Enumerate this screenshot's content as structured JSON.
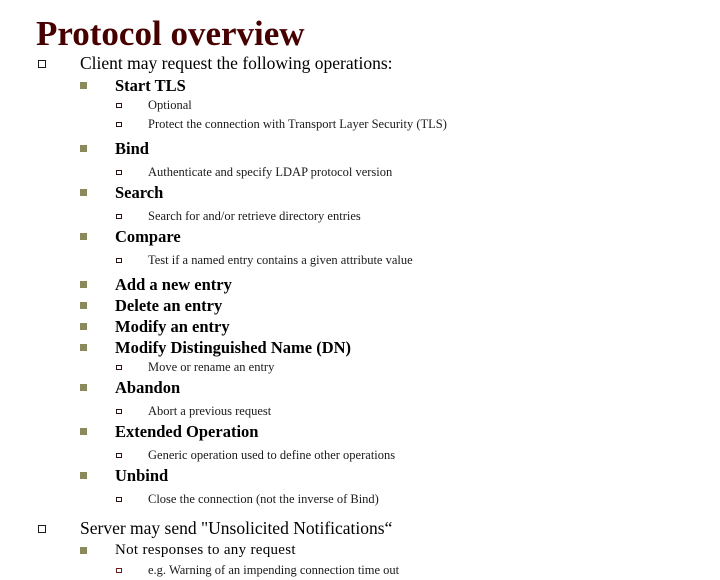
{
  "slide": {
    "title": "Protocol overview",
    "title_color": "#470000",
    "background_color": "#ffffff",
    "bullet_colors": {
      "level1": "#1a1a1a",
      "level2": "#8a8a5c",
      "level3": "#2b1414",
      "level3_accent": "#6b2020"
    },
    "outline": {
      "client_section": {
        "heading": "Client may request the following operations:",
        "operations": [
          {
            "name": "Start TLS",
            "details": [
              "Optional",
              "Protect the connection with Transport Layer Security (TLS)"
            ]
          },
          {
            "name": "Bind",
            "details": [
              "Authenticate and specify LDAP protocol version"
            ]
          },
          {
            "name": "Search",
            "details": [
              "Search for and/or retrieve directory entries"
            ]
          },
          {
            "name": "Compare",
            "details": [
              "Test if a named entry contains a given attribute value"
            ]
          },
          {
            "name": "Add a new entry",
            "details": []
          },
          {
            "name": "Delete an entry",
            "details": []
          },
          {
            "name": "Modify an entry",
            "details": []
          },
          {
            "name": "Modify Distinguished Name (DN)",
            "details": [
              "Move or rename an entry"
            ]
          },
          {
            "name": "Abandon",
            "details": [
              "Abort a previous request"
            ]
          },
          {
            "name": "Extended Operation",
            "details": [
              "Generic operation used to define other operations"
            ]
          },
          {
            "name": "Unbind",
            "details": [
              "Close the connection (not the inverse of Bind)"
            ]
          }
        ]
      },
      "server_section": {
        "heading": "Server may send \"Unsolicited Notifications“",
        "items": [
          {
            "name": "Not responses to any request",
            "details": [
              "e.g. Warning of an impending connection time out"
            ]
          }
        ]
      }
    }
  }
}
